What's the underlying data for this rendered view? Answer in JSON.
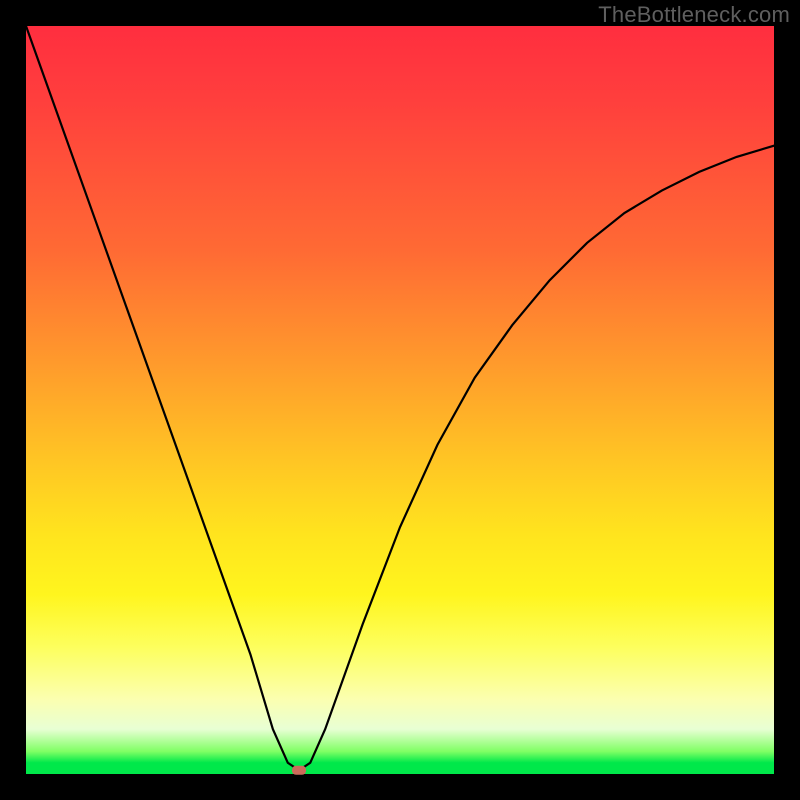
{
  "watermark": "TheBottleneck.com",
  "chart_data": {
    "type": "line",
    "title": "",
    "xlabel": "",
    "ylabel": "",
    "xlim": [
      0,
      100
    ],
    "ylim": [
      0,
      100
    ],
    "legend": false,
    "grid": false,
    "series": [
      {
        "name": "bottleneck-curve",
        "x": [
          0,
          5,
          10,
          15,
          20,
          25,
          30,
          33,
          35,
          36.5,
          38,
          40,
          45,
          50,
          55,
          60,
          65,
          70,
          75,
          80,
          85,
          90,
          95,
          100
        ],
        "values": [
          100,
          86,
          72,
          58,
          44,
          30,
          16,
          6,
          1.5,
          0.5,
          1.5,
          6,
          20,
          33,
          44,
          53,
          60,
          66,
          71,
          75,
          78,
          80.5,
          82.5,
          84
        ]
      }
    ],
    "background_gradient": {
      "orientation": "vertical",
      "stops": [
        {
          "pos": 0.0,
          "color": "#ff2e3f"
        },
        {
          "pos": 0.45,
          "color": "#ff9a2c"
        },
        {
          "pos": 0.7,
          "color": "#ffe41e"
        },
        {
          "pos": 0.9,
          "color": "#fbffb0"
        },
        {
          "pos": 0.98,
          "color": "#00e84a"
        },
        {
          "pos": 1.0,
          "color": "#00e84a"
        }
      ]
    },
    "optimum_marker": {
      "x": 36.5,
      "y": 0.5,
      "color": "#cc6a5a"
    }
  }
}
